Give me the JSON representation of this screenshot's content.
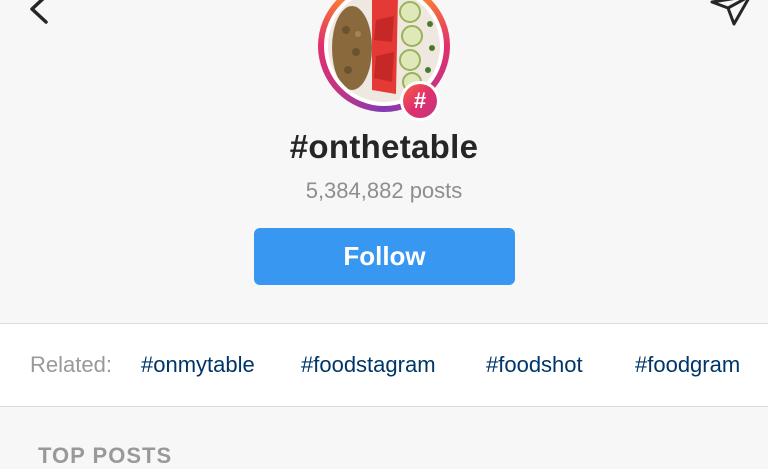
{
  "hashtag": {
    "title": "#onthetable",
    "post_count": "5,384,882 posts",
    "badge_symbol": "#"
  },
  "actions": {
    "follow_label": "Follow"
  },
  "related": {
    "label": "Related:",
    "tags": [
      "#onmytable",
      "#foodstagram",
      "#foodshot",
      "#foodgram"
    ]
  },
  "sections": {
    "top_posts_label": "TOP POSTS"
  },
  "icons": {
    "back": "chevron-left-icon",
    "share": "paper-plane-icon",
    "badge": "hashtag-icon"
  },
  "colors": {
    "follow_button": "#3897f0",
    "related_tag": "#003569",
    "muted_text": "#8e8e8e"
  }
}
